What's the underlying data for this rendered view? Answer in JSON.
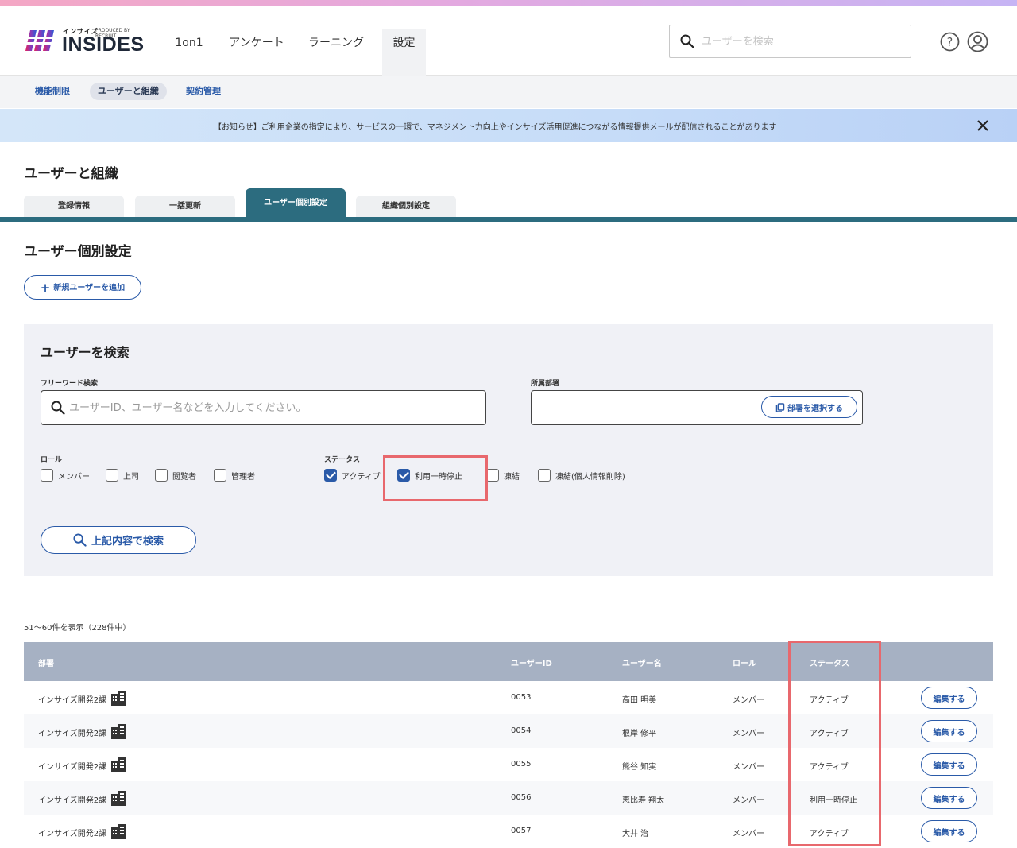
{
  "brand": {
    "name": "INSIDES",
    "kana": "インサイズ",
    "tagline": "PRODUCED BY RECRUIT"
  },
  "nav": [
    {
      "label": "1on1",
      "active": false
    },
    {
      "label": "アンケート",
      "active": false
    },
    {
      "label": "ラーニング",
      "active": false
    },
    {
      "label": "設定",
      "active": true
    }
  ],
  "header_search": {
    "placeholder": "ユーザーを検索"
  },
  "subnav": [
    {
      "label": "機能制限",
      "active": false
    },
    {
      "label": "ユーザーと組織",
      "active": true
    },
    {
      "label": "契約管理",
      "active": false
    }
  ],
  "notice": "【お知らせ】ご利用企業の指定により、サービスの一環で、マネジメント力向上やインサイズ活用促進につながる情報提供メールが配信されることがあります",
  "page_title": "ユーザーと組織",
  "tabs": [
    {
      "label": "登録情報",
      "active": false
    },
    {
      "label": "一括更新",
      "active": false
    },
    {
      "label": "ユーザー個別設定",
      "active": true
    },
    {
      "label": "組織個別設定",
      "active": false
    }
  ],
  "section_title": "ユーザー個別設定",
  "add_user_label": "新規ユーザーを追加",
  "search_panel": {
    "title": "ユーザーを検索",
    "freeword_label": "フリーワード検索",
    "freeword_placeholder": "ユーザーID、ユーザー名などを入力してください。",
    "dept_label": "所属部署",
    "dept_button": "部署を選択する",
    "role_label": "ロール",
    "roles": [
      {
        "label": "メンバー",
        "checked": false
      },
      {
        "label": "上司",
        "checked": false
      },
      {
        "label": "閲覧者",
        "checked": false
      },
      {
        "label": "管理者",
        "checked": false
      }
    ],
    "status_label": "ステータス",
    "statuses": [
      {
        "label": "アクティブ",
        "checked": true
      },
      {
        "label": "利用一時停止",
        "checked": true
      },
      {
        "label": "凍結",
        "checked": false
      },
      {
        "label": "凍結(個人情報削除)",
        "checked": false
      }
    ],
    "search_button": "上記内容で検索"
  },
  "result_count": "51〜60件を表示（228件中）",
  "table": {
    "headers": {
      "dept": "部署",
      "user_id": "ユーザーID",
      "user_name": "ユーザー名",
      "role": "ロール",
      "status": "ステータス"
    },
    "edit_label": "編集する",
    "rows": [
      {
        "dept": "インサイズ開発2課",
        "user_id": "0053",
        "user_name": "高田 明美",
        "role": "メンバー",
        "status": "アクティブ"
      },
      {
        "dept": "インサイズ開発2課",
        "user_id": "0054",
        "user_name": "根岸 修平",
        "role": "メンバー",
        "status": "アクティブ"
      },
      {
        "dept": "インサイズ開発2課",
        "user_id": "0055",
        "user_name": "熊谷 知実",
        "role": "メンバー",
        "status": "アクティブ"
      },
      {
        "dept": "インサイズ開発2課",
        "user_id": "0056",
        "user_name": "恵比寿 翔太",
        "role": "メンバー",
        "status": "利用一時停止"
      },
      {
        "dept": "インサイズ開発2課",
        "user_id": "0057",
        "user_name": "大井 治",
        "role": "メンバー",
        "status": "アクティブ"
      }
    ]
  },
  "colors": {
    "primary": "#2a5aa8",
    "tab_active": "#2c6c7f",
    "highlight": "#e8686d",
    "table_header": "#a6b1c3"
  }
}
